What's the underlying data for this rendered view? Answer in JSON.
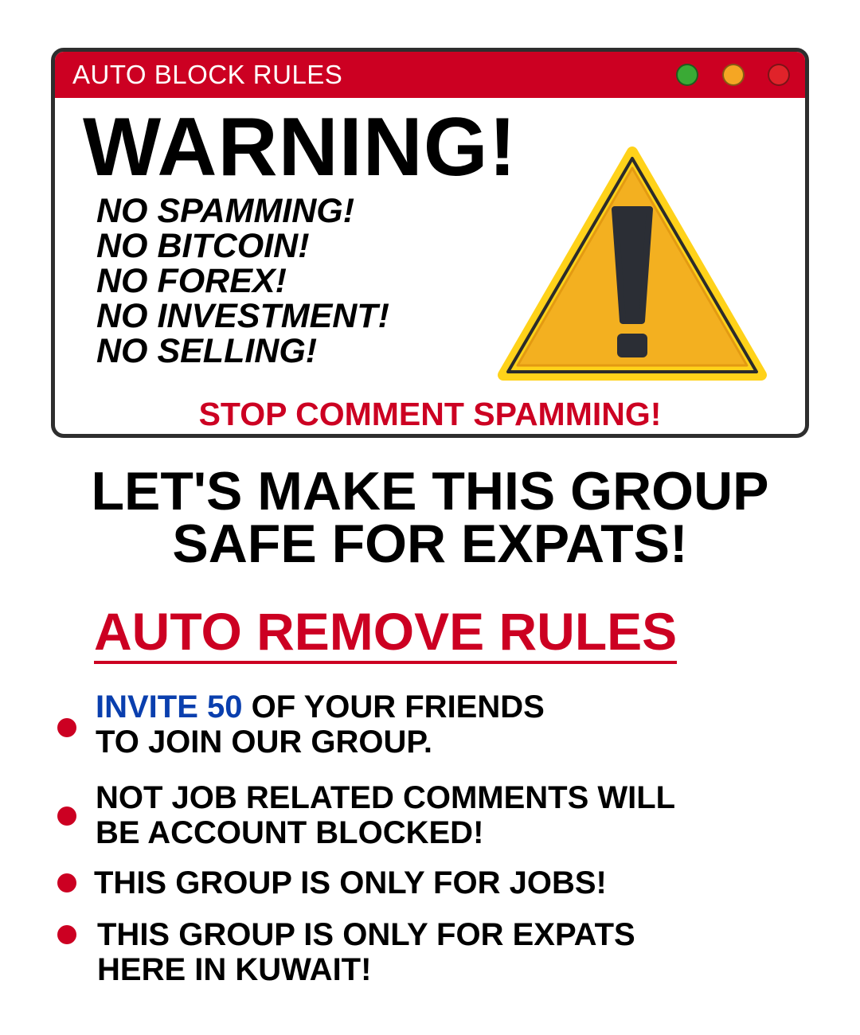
{
  "window": {
    "title": "AUTO BLOCK RULES",
    "controls": [
      {
        "name": "green",
        "color": "#3aaa35"
      },
      {
        "name": "yellow",
        "color": "#f5a623"
      },
      {
        "name": "red",
        "color": "#e0232a"
      }
    ]
  },
  "warning": {
    "title": "WARNING!",
    "rules": [
      "NO SPAMMING!",
      "NO BITCOIN!",
      "NO FOREX!",
      "NO INVESTMENT!",
      "NO SELLING!"
    ],
    "icon": "warning-triangle-icon",
    "stop_text": "STOP COMMENT SPAMMING!"
  },
  "headline": {
    "line1": "LET'S MAKE THIS GROUP",
    "line2": "SAFE FOR EXPATS!"
  },
  "remove_rules": {
    "heading": "AUTO REMOVE RULES",
    "items": [
      {
        "highlight": "INVITE 50",
        "line1": " OF YOUR FRIENDS",
        "line2": "TO JOIN OUR GROUP."
      },
      {
        "line1": "NOT JOB RELATED COMMENTS WILL",
        "line2": "BE ACCOUNT BLOCKED!"
      },
      {
        "line1": "THIS GROUP IS ONLY FOR JOBS!"
      },
      {
        "line1": "THIS GROUP IS ONLY FOR EXPATS",
        "line2": "HERE IN KUWAIT!"
      }
    ]
  },
  "colors": {
    "accent_red": "#cc0022",
    "highlight_blue": "#0a3fae",
    "triangle_fill": "#f3b020",
    "triangle_border": "#ffd21a"
  }
}
